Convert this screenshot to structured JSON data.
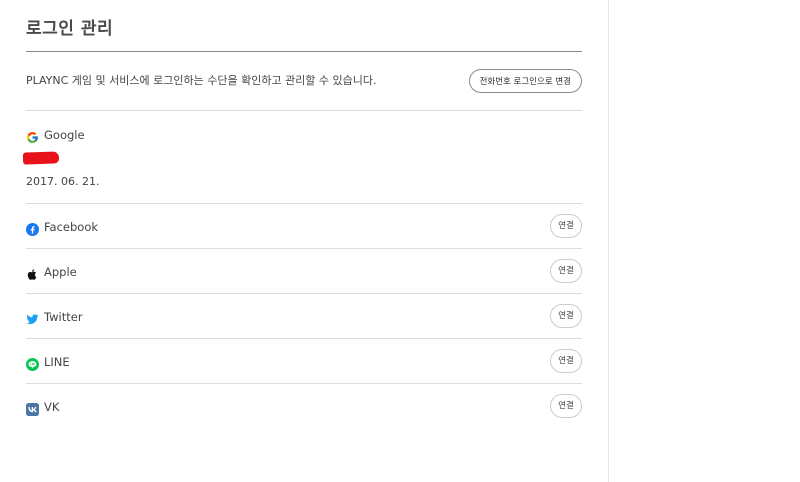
{
  "page": {
    "title": "로그인 관리",
    "description": "PLAYNC 게임 및 서비스에 로그인하는 수단을 확인하고 관리할 수 있습니다.",
    "phone_login_button": "전화번호 로그인으로 변경"
  },
  "linked_account": {
    "provider": "Google",
    "icon": "google-icon",
    "date": "2017. 06. 21."
  },
  "providers": [
    {
      "name": "Facebook",
      "icon": "facebook-icon",
      "color": "#1877f2",
      "action": "연결"
    },
    {
      "name": "Apple",
      "icon": "apple-icon",
      "color": "#000000",
      "action": "연결"
    },
    {
      "name": "Twitter",
      "icon": "twitter-icon",
      "color": "#1da1f2",
      "action": "연결"
    },
    {
      "name": "LINE",
      "icon": "line-icon",
      "color": "#06c755",
      "action": "연결"
    },
    {
      "name": "VK",
      "icon": "vk-icon",
      "color": "#4c75a3",
      "action": "연결"
    }
  ]
}
